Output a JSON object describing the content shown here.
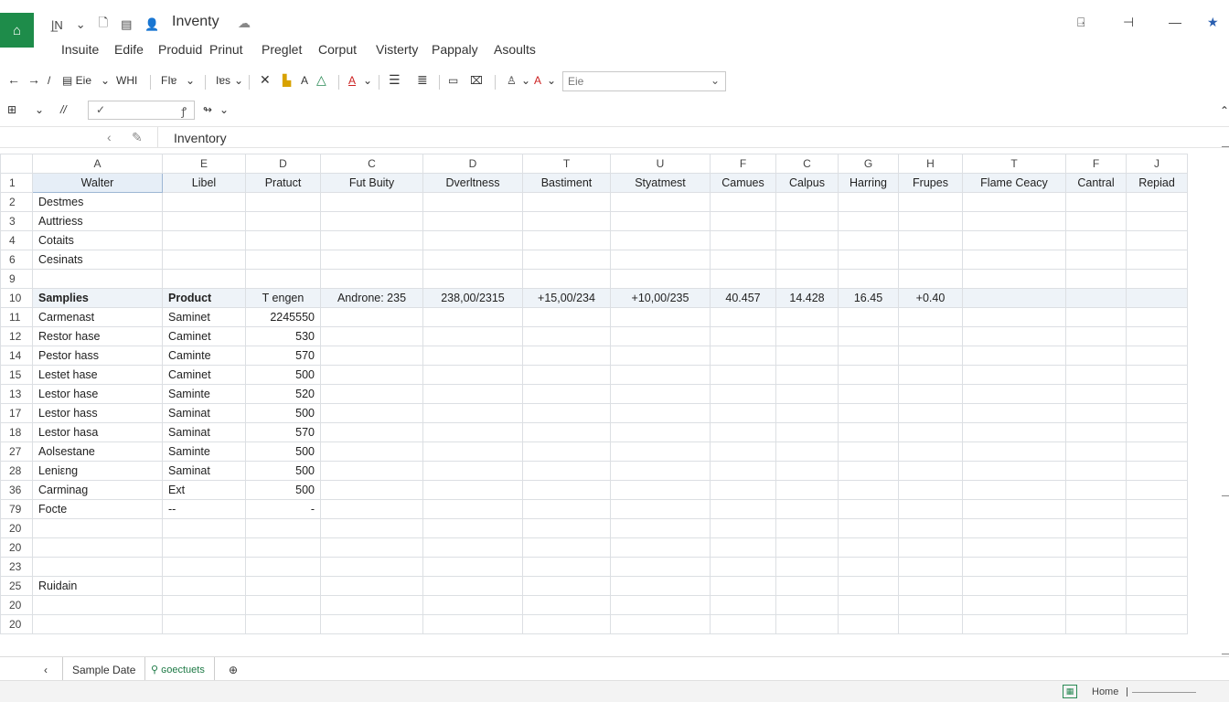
{
  "title_bar": {
    "document_title": "Inventy",
    "app_icon": "home-sheet-icon",
    "quick_icons": [
      "sidebar-toggle-icon",
      "dropdown-caret-icon",
      "document-icon",
      "save-icon",
      "user-icon"
    ]
  },
  "menu": {
    "items": [
      "Insuite",
      "Edife",
      "Produid",
      "Prinut",
      "Preglet",
      "Corput",
      "Visterty",
      "Pappaly",
      "Asoults"
    ]
  },
  "toolbar": {
    "file_label": "Eie",
    "whl_label": "WHI",
    "fie_label": "FIɐ",
    "ias_label": "Iɐs",
    "font_select_value": "Eie"
  },
  "formula_bar": {
    "content": "Inventory"
  },
  "columns": [
    "A",
    "E",
    "D",
    "C",
    "D",
    "T",
    "U",
    "F",
    "C",
    "G",
    "H",
    "T",
    "F",
    "J"
  ],
  "rows": [
    {
      "num": "1",
      "type": "hdr",
      "cells": [
        "Walter",
        "Libel",
        "Pratuct",
        "Fut Buity",
        "Dverltness",
        "Bastiment",
        "Styatmest",
        "Camues",
        "Calpus",
        "Harring",
        "Frupes",
        "Flame Ceacy",
        "Cantral",
        "Repiad"
      ]
    },
    {
      "num": "2",
      "cells": [
        "Destmes",
        "",
        "",
        "",
        "",
        "",
        "",
        "",
        "",
        "",
        "",
        "",
        "",
        ""
      ]
    },
    {
      "num": "3",
      "cells": [
        "Auttriess",
        "",
        "",
        "",
        "",
        "",
        "",
        "",
        "",
        "",
        "",
        "",
        "",
        ""
      ]
    },
    {
      "num": "4",
      "cells": [
        "Cotaits",
        "",
        "",
        "",
        "",
        "",
        "",
        "",
        "",
        "",
        "",
        "",
        "",
        ""
      ]
    },
    {
      "num": "6",
      "cells": [
        "Cesinats",
        "",
        "",
        "",
        "",
        "",
        "",
        "",
        "",
        "",
        "",
        "",
        "",
        ""
      ]
    },
    {
      "num": "9",
      "cells": [
        "",
        "",
        "",
        "",
        "",
        "",
        "",
        "",
        "",
        "",
        "",
        "",
        "",
        ""
      ]
    },
    {
      "num": "10",
      "type": "band",
      "cells": [
        "Samplies",
        "Product",
        "T engen",
        "Androne: 235",
        "238,00/2315",
        "+15,00/234",
        "+10,00/235",
        "40.457",
        "14.428",
        "16.45",
        "+0.40",
        "",
        "",
        ""
      ]
    },
    {
      "num": "11",
      "cells": [
        "Carmenast",
        "Saminet",
        "2245550",
        "",
        "",
        "",
        "",
        "",
        "",
        "",
        "",
        "",
        "",
        ""
      ]
    },
    {
      "num": "12",
      "cells": [
        "Restor hase",
        "Caminet",
        "530",
        "",
        "",
        "",
        "",
        "",
        "",
        "",
        "",
        "",
        "",
        ""
      ]
    },
    {
      "num": "14",
      "cells": [
        "Pestor hass",
        "Caminte",
        "570",
        "",
        "",
        "",
        "",
        "",
        "",
        "",
        "",
        "",
        "",
        ""
      ]
    },
    {
      "num": "15",
      "cells": [
        "Lestet hase",
        "Caminet",
        "500",
        "",
        "",
        "",
        "",
        "",
        "",
        "",
        "",
        "",
        "",
        ""
      ]
    },
    {
      "num": "13",
      "cells": [
        "Lestor hase",
        "Saminte",
        "520",
        "",
        "",
        "",
        "",
        "",
        "",
        "",
        "",
        "",
        "",
        ""
      ]
    },
    {
      "num": "17",
      "cells": [
        "Lestor hass",
        "Saminat",
        "500",
        "",
        "",
        "",
        "",
        "",
        "",
        "",
        "",
        "",
        "",
        ""
      ]
    },
    {
      "num": "18",
      "cells": [
        "Lestor hasa",
        "Saminat",
        "570",
        "",
        "",
        "",
        "",
        "",
        "",
        "",
        "",
        "",
        "",
        ""
      ]
    },
    {
      "num": "27",
      "cells": [
        "Aolsestane",
        "Saminte",
        "500",
        "",
        "",
        "",
        "",
        "",
        "",
        "",
        "",
        "",
        "",
        ""
      ]
    },
    {
      "num": "28",
      "cells": [
        "Leniεng",
        "Saminat",
        "500",
        "",
        "",
        "",
        "",
        "",
        "",
        "",
        "",
        "",
        "",
        ""
      ]
    },
    {
      "num": "36",
      "cells": [
        "Carminag",
        "Ext",
        "500",
        "",
        "",
        "",
        "",
        "",
        "",
        "",
        "",
        "",
        "",
        ""
      ]
    },
    {
      "num": "79",
      "cells": [
        "Focte",
        "--",
        "-",
        "",
        "",
        "",
        "",
        "",
        "",
        "",
        "",
        "",
        "",
        ""
      ]
    },
    {
      "num": "20",
      "cells": [
        "",
        "",
        "",
        "",
        "",
        "",
        "",
        "",
        "",
        "",
        "",
        "",
        "",
        ""
      ]
    },
    {
      "num": "20",
      "cells": [
        "",
        "",
        "",
        "",
        "",
        "",
        "",
        "",
        "",
        "",
        "",
        "",
        "",
        ""
      ]
    },
    {
      "num": "23",
      "cells": [
        "",
        "",
        "",
        "",
        "",
        "",
        "",
        "",
        "",
        "",
        "",
        "",
        "",
        ""
      ]
    },
    {
      "num": "25",
      "cells": [
        "Ruidain",
        "",
        "",
        "",
        "",
        "",
        "",
        "",
        "",
        "",
        "",
        "",
        "",
        ""
      ]
    },
    {
      "num": "20",
      "cells": [
        "",
        "",
        "",
        "",
        "",
        "",
        "",
        "",
        "",
        "",
        "",
        "",
        "",
        ""
      ]
    },
    {
      "num": "20",
      "cells": [
        "",
        "",
        "",
        "",
        "",
        "",
        "",
        "",
        "",
        "",
        "",
        "",
        "",
        ""
      ]
    }
  ],
  "sheet_tabs": {
    "active": "Sample Date",
    "second": "ɢoectuets"
  },
  "status_bar": {
    "label": "Home"
  }
}
